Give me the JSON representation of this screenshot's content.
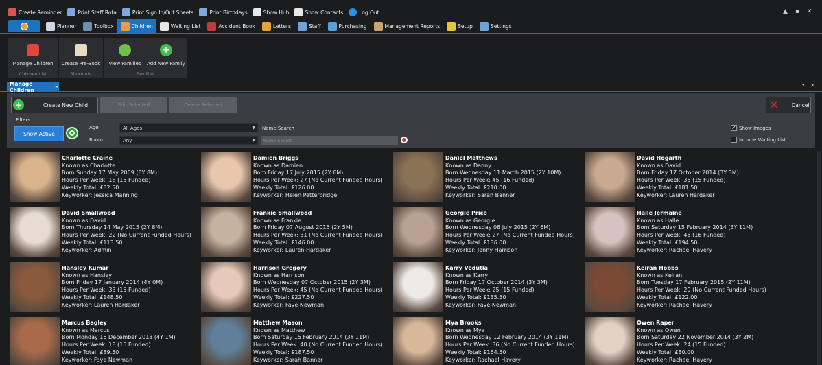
{
  "quick_access": [
    {
      "label": "Create Reminder",
      "icon": "reminder-icon",
      "color": "#d9534f"
    },
    {
      "label": "Print Staff Rota",
      "icon": "printer-icon",
      "color": "#7fa7d9"
    },
    {
      "label": "Print Sign In/Out Sheets",
      "icon": "printer-icon",
      "color": "#7fa7d9"
    },
    {
      "label": "Print Birthdays",
      "icon": "people-icon",
      "color": "#7fa7d9"
    },
    {
      "label": "Show Hub",
      "icon": "house-icon",
      "color": "#e8e8e8"
    },
    {
      "label": "Show Contacts",
      "icon": "contacts-icon",
      "color": "#e8e8e8"
    },
    {
      "label": "Log Out",
      "icon": "lock-icon",
      "color": "#2d8ee8"
    }
  ],
  "window_controls": [
    "▲",
    "▪",
    "✕"
  ],
  "menu": [
    {
      "label": "Planner",
      "icon": "planner-icon",
      "color": "#cfd8e3"
    },
    {
      "label": "Toolbox",
      "icon": "toolbox-icon",
      "color": "#6c8fb5"
    },
    {
      "label": "Children",
      "icon": "children-icon",
      "color": "#f29b3a"
    },
    {
      "label": "Waiting List",
      "icon": "waiting-list-icon",
      "color": "#e6e6e6"
    },
    {
      "label": "Accident Book",
      "icon": "accident-book-icon",
      "color": "#c23b3b"
    },
    {
      "label": "Letters",
      "icon": "letters-icon",
      "color": "#e8a23a"
    },
    {
      "label": "Staff",
      "icon": "staff-icon",
      "color": "#6ea2d8"
    },
    {
      "label": "Purchasing",
      "icon": "purchasing-icon",
      "color": "#5aa0d8"
    },
    {
      "label": "Management Reports",
      "icon": "reports-icon",
      "color": "#c9a66b"
    },
    {
      "label": "Setup",
      "icon": "setup-icon",
      "color": "#e8c23a"
    },
    {
      "label": "Settings",
      "icon": "settings-icon",
      "color": "#6ea2d8"
    }
  ],
  "ribbon": {
    "manage_children": "Manage Children",
    "create_prebook": "Create Pre-Book",
    "view_families": "View Families",
    "add_new_family": "Add New Family",
    "group_children_list": "Children List",
    "group_shortcuts": "Shortcuts",
    "group_families": "Families"
  },
  "document_tab": {
    "label": "Manage Children",
    "close": "✕"
  },
  "toolbar": {
    "create_new_child": "Create New Child",
    "edit_selected": "Edit Selected",
    "delete_selected": "Delete Selected",
    "cancel": "Cancel"
  },
  "filters": {
    "title": "Filters",
    "show_active": "Show Active",
    "age_label": "Age",
    "age_value": "All Ages",
    "room_label": "Room",
    "room_value": "Any",
    "name_search_label": "Name Search",
    "name_search_placeholder": "Name Search",
    "show_images_label": "Show Images",
    "show_images_checked": true,
    "include_waiting_list_label": "Include Waiting List",
    "include_waiting_list_checked": false
  },
  "children": [
    {
      "name": "Charlotte Craine",
      "known_as": "Known as Charlotte",
      "born": "Born Sunday 17 May 2009 (8Y 8M)",
      "hours": "Hours Per Week: 18 (15 Funded)",
      "weekly": "Weekly Total: £82.50",
      "keyworker": "Keyworker: Jessica Manning",
      "photo_color": "#d9b38c"
    },
    {
      "name": "Damien Briggs",
      "known_as": "Known as Damien",
      "born": "Born Friday 17 July 2015 (2Y 6M)",
      "hours": "Hours Per Week: 27 (No Current Funded Hours)",
      "weekly": "Weekly Total: £126.00",
      "keyworker": "Keyworker: Helen Petterbridge",
      "photo_color": "#e9c7ad"
    },
    {
      "name": "Daniel Matthews",
      "known_as": "Known as Danny",
      "born": "Born Wednesday 11 March 2015 (2Y 10M)",
      "hours": "Hours Per Week: 45 (16 Funded)",
      "weekly": "Weekly Total: £210.00",
      "keyworker": "Keyworker: Sarah Banner",
      "photo_color": "#8a7355"
    },
    {
      "name": "David Hogarth",
      "known_as": "Known as David",
      "born": "Born Friday 17 October 2014 (3Y 3M)",
      "hours": "Hours Per Week: 35 (15 Funded)",
      "weekly": "Weekly Total: £181.50",
      "keyworker": "Keyworker: Lauren Hardaker",
      "photo_color": "#c9a98f"
    },
    {
      "name": "David Smallwood",
      "known_as": "Known as David",
      "born": "Born Thursday 14 May 2015 (2Y 8M)",
      "hours": "Hours Per Week: 22 (No Current Funded Hours)",
      "weekly": "Weekly Total: £113.50",
      "keyworker": "Keyworker: Admin",
      "photo_color": "#e8dcd2"
    },
    {
      "name": "Frankie Smallwood",
      "known_as": "Known as Frankie",
      "born": "Born Friday 07 August 2015 (2Y 5M)",
      "hours": "Hours Per Week: 31 (No Current Funded Hours)",
      "weekly": "Weekly Total: £146.00",
      "keyworker": "Keyworker: Lauren Hardaker",
      "photo_color": "#c7b2a0"
    },
    {
      "name": "Georgie Price",
      "known_as": "Known as Georgie",
      "born": "Born Wednesday 08 July 2015 (2Y 6M)",
      "hours": "Hours Per Week: 27 (No Current Funded Hours)",
      "weekly": "Weekly Total: £136.00",
      "keyworker": "Keyworker: Jenny Harrison",
      "photo_color": "#b9a293"
    },
    {
      "name": "Halle Jermaine",
      "known_as": "Known as Halle",
      "born": "Born Saturday 15 February 2014 (3Y 11M)",
      "hours": "Hours Per Week: 45 (16 Funded)",
      "weekly": "Weekly Total: £194.50",
      "keyworker": "Keyworker: Rachael Havery",
      "photo_color": "#d8c2c0"
    },
    {
      "name": "Hansley Kumar",
      "known_as": "Known as Hansley",
      "born": "Born Friday 17 January 2014 (4Y 0M)",
      "hours": "Hours Per Week: 33 (15 Funded)",
      "weekly": "Weekly Total: £148.50",
      "keyworker": "Keyworker: Lauren Hardaker",
      "photo_color": "#8a5a3c"
    },
    {
      "name": "Harrison Gregory",
      "known_as": "Known as Harrison",
      "born": "Born Wednesday 07 October 2015 (2Y 3M)",
      "hours": "Hours Per Week: 45 (No Current Funded Hours)",
      "weekly": "Weekly Total: £227.50",
      "keyworker": "Keyworker: Faye Newman",
      "photo_color": "#e6c9b8"
    },
    {
      "name": "Karry Vedutla",
      "known_as": "Known as Karry",
      "born": "Born Friday 17 October 2014 (3Y 3M)",
      "hours": "Hours Per Week: 25 (15 Funded)",
      "weekly": "Weekly Total: £135.50",
      "keyworker": "Keyworker: Faye Newman",
      "photo_color": "#ece9e6"
    },
    {
      "name": "Keiran Hobbs",
      "known_as": "Known as Keiran",
      "born": "Born Tuesday 17 February 2015 (2Y 11M)",
      "hours": "Hours Per Week: 29 (No Current Funded Hours)",
      "weekly": "Weekly Total: £122.00",
      "keyworker": "Keyworker: Rachael Havery",
      "photo_color": "#7a4a35"
    },
    {
      "name": "Marcus Bagley",
      "known_as": "Known as Marcus",
      "born": "Born Monday 16 December 2013 (4Y 1M)",
      "hours": "Hours Per Week: 18 (15 Funded)",
      "weekly": "Weekly Total: £89.50",
      "keyworker": "Keyworker: Faye Newman",
      "photo_color": "#a86a4a"
    },
    {
      "name": "Matthew Mason",
      "known_as": "Known as Matthew",
      "born": "Born Saturday 15 February 2014 (3Y 11M)",
      "hours": "Hours Per Week: 40 (No Current Funded Hours)",
      "weekly": "Weekly Total: £187.50",
      "keyworker": "Keyworker: Sarah Banner",
      "photo_color": "#5f7f9a"
    },
    {
      "name": "Mya Brooks",
      "known_as": "Known as Mya",
      "born": "Born Wednesday 12 February 2014 (3Y 11M)",
      "hours": "Hours Per Week: 36 (No Current Funded Hours)",
      "weekly": "Weekly Total: £164.50",
      "keyworker": "Keyworker: Rachael Havery",
      "photo_color": "#d8b89a"
    },
    {
      "name": "Owen Raper",
      "known_as": "Known as Owen",
      "born": "Born Saturday 22 November 2014 (3Y 2M)",
      "hours": "Hours Per Week: 24 (15 Funded)",
      "weekly": "Weekly Total: £80.00",
      "keyworker": "Keyworker: Rachael Havery",
      "photo_color": "#e3d2c4"
    }
  ],
  "colors": {
    "accent": "#1e73be",
    "background": "#1b1c1e",
    "panel": "#3b3d42"
  }
}
